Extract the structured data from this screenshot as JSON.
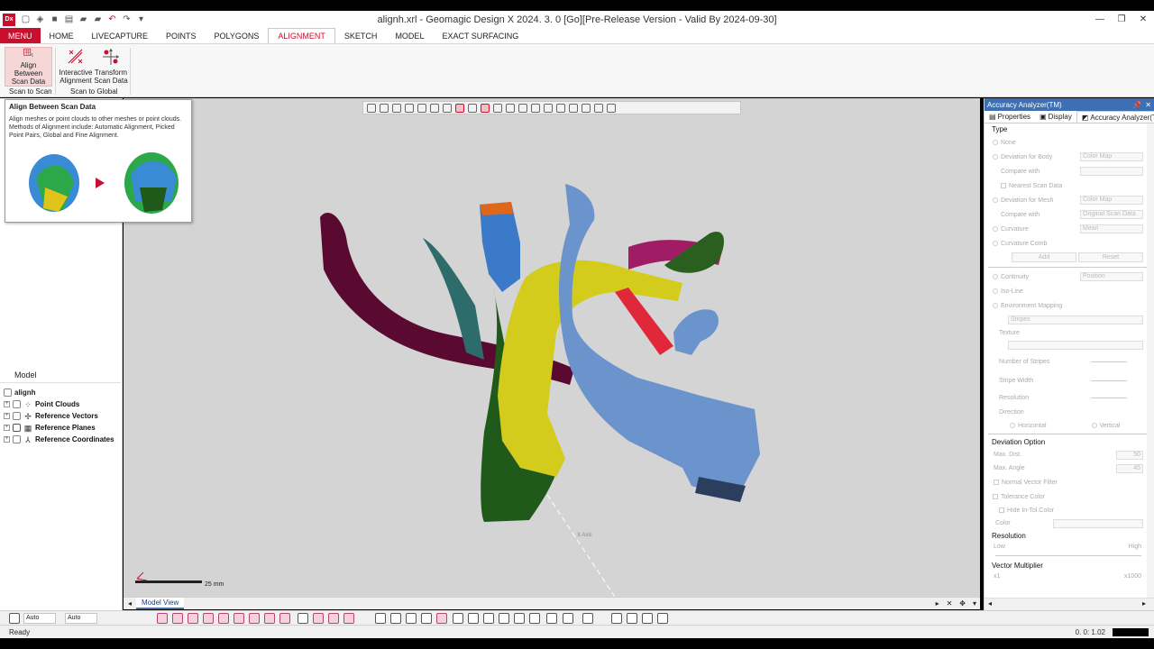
{
  "app": {
    "logo": "Dx",
    "window_title": "alignh.xrl - Geomagic Design X 2024. 3. 0 [Go][Pre-Release Version - Valid By 2024-09-30]"
  },
  "ribbon": {
    "menu_label": "MENU",
    "tabs": [
      "HOME",
      "LIVECAPTURE",
      "POINTS",
      "POLYGONS",
      "ALIGNMENT",
      "SKETCH",
      "MODEL",
      "EXACT SURFACING"
    ],
    "active_tab": "ALIGNMENT",
    "buttons": {
      "align_between_line1": "Align Between",
      "align_between_line2": "Scan Data",
      "interactive_line1": "Interactive",
      "interactive_line2": "Alignment",
      "transform_line1": "Transform",
      "transform_line2": "Scan Data"
    },
    "groups": {
      "scan_to_scan": "Scan to Scan",
      "scan_to_global": "Scan to Global"
    }
  },
  "tooltip": {
    "title": "Align Between Scan Data",
    "body": "Align meshes or point clouds to other meshes or point clouds. Methods of Alignment include: Automatic Alignment, Picked Point Pairs, Global and Fine Alignment."
  },
  "model_tree": {
    "header": "Model",
    "root": "alignh",
    "items": [
      {
        "label": "Point Clouds",
        "icon": "point-cloud-icon"
      },
      {
        "label": "Reference Vectors",
        "icon": "vector-icon"
      },
      {
        "label": "Reference Planes",
        "icon": "plane-icon"
      },
      {
        "label": "Reference Coordinates",
        "icon": "coordinates-icon"
      }
    ]
  },
  "viewport": {
    "scale_label": "25 mm",
    "axis_label": "X Axis",
    "view_tab": "Model View"
  },
  "bottom": {
    "select1": "Auto",
    "select2": "Auto"
  },
  "status": {
    "text": "Ready",
    "coords": "0. 0: 1.02"
  },
  "right_panel": {
    "title": "Accuracy Analyzer(TM)",
    "tabs": [
      "Properties",
      "Display",
      "Accuracy Analyzer(TM)"
    ],
    "type_section": "Type",
    "type_options": [
      {
        "label": "None"
      },
      {
        "label": "Deviation for Body",
        "value": "Color Map"
      },
      {
        "label": "Compare with",
        "value": ""
      },
      {
        "label": "Nearest Scan Data"
      },
      {
        "label": "Deviation for Mesh",
        "value": "Color Map"
      },
      {
        "label": "Compare with",
        "value": "Original Scan Data"
      },
      {
        "label": "Curvature",
        "value": "Mean"
      },
      {
        "label": "Curvature Comb"
      }
    ],
    "add_label": "Add",
    "reset_label": "Reset",
    "continuity": {
      "label": "Continuity",
      "value": "Position"
    },
    "iso_line": "Iso-Line",
    "env_mapping": "Environment Mapping",
    "stripes": "Stripes",
    "texture": "Texture",
    "number_of_stripes": "Number of Stripes",
    "stripe_width": "Stripe Width",
    "resolution": "Resolution",
    "direction": "Direction",
    "horizontal": "Horizontal",
    "vertical": "Vertical",
    "deviation_option": "Deviation Option",
    "max_dist": {
      "label": "Max. Dist.",
      "value": "50"
    },
    "max_angle": {
      "label": "Max. Angle",
      "value": "45"
    },
    "normal_vector_filter": "Normal Vector Filter",
    "tolerance_color": "Tolerance Color",
    "hide_in_tol": "Hide In-Tol.Color",
    "color": "Color",
    "resolution_section": "Resolution",
    "low": "Low",
    "high": "High",
    "vector_multiplier": "Vector Multiplier",
    "x1": "x1",
    "x1000": "x1000"
  },
  "colors": {
    "brand_red": "#c8102e",
    "panel_blue": "#3c6fb3",
    "viewport_bg": "#d4d4d4"
  }
}
